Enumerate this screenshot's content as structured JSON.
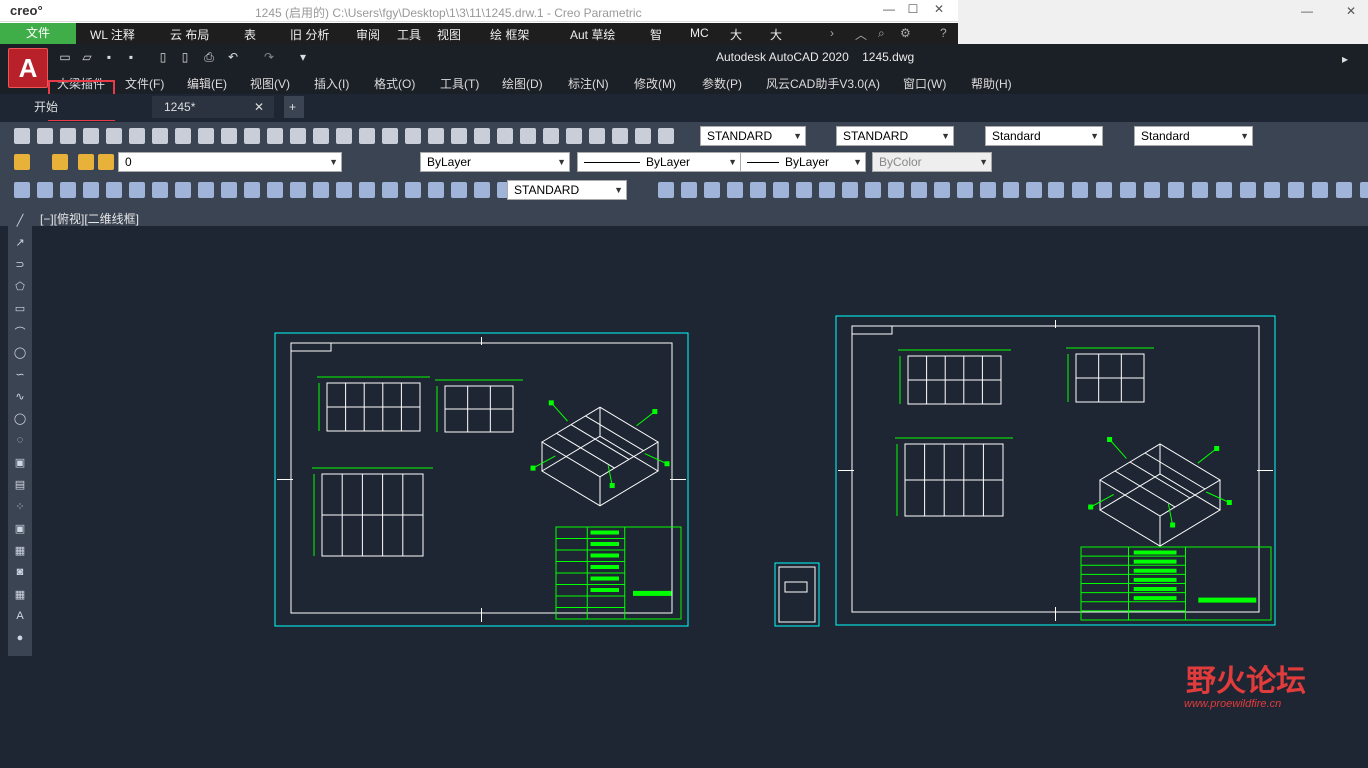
{
  "creo": {
    "logo": "creo°",
    "title": "1245 (启用的) C:\\Users\\fgy\\Desktop\\1\\3\\11\\1245.drw.1 - Creo Parametric",
    "file_tab": "文件",
    "tabs": [
      "WL 注释",
      "云 布局",
      "表",
      "旧 分析",
      "审阅",
      "工具",
      "视图",
      "绘 框架",
      "Aut 草绘",
      "智",
      "MC",
      "大",
      "大"
    ]
  },
  "autocad": {
    "logo": "A",
    "title": "Autodesk AutoCAD 2020",
    "filename": "1245.dwg",
    "menu": [
      "大梁插件",
      "文件(F)",
      "编辑(E)",
      "视图(V)",
      "插入(I)",
      "格式(O)",
      "工具(T)",
      "绘图(D)",
      "标注(N)",
      "修改(M)",
      "参数(P)",
      "风云CAD助手V3.0(A)",
      "窗口(W)",
      "帮助(H)"
    ],
    "tabs": [
      {
        "label": "开始"
      },
      {
        "label": "1245*"
      }
    ],
    "styles": {
      "text_style": "STANDARD",
      "dim_style": "STANDARD",
      "table_style": "Standard",
      "mleader_style": "Standard",
      "layer": "0",
      "color": "ByLayer",
      "linetype": "ByLayer",
      "lineweight": "ByLayer",
      "plotstyle": "ByColor",
      "dim_style2": "STANDARD"
    },
    "viewport_label": "[−][俯视][二维线框]",
    "highlight_color": "#e83a47",
    "drawing_color_frame": "#00ffff",
    "drawing_color_geometry": "#ffffff",
    "drawing_color_dims": "#00ff00"
  },
  "watermark": {
    "name": "野火论坛",
    "url": "www.proewildfire.cn"
  }
}
